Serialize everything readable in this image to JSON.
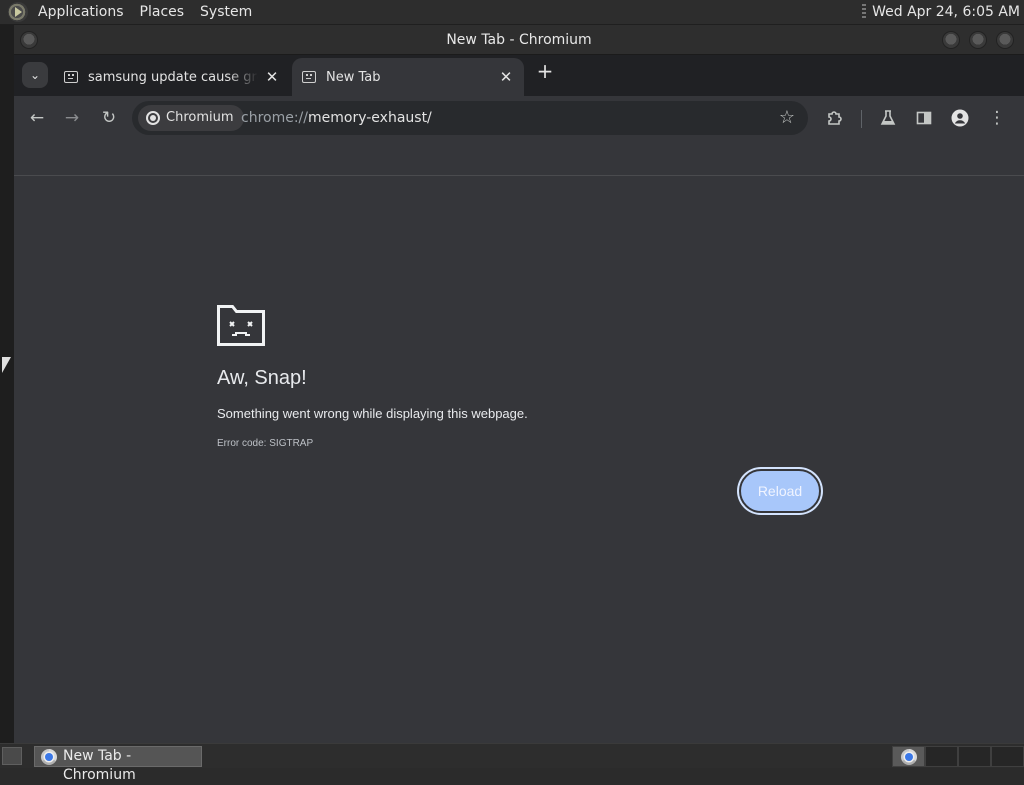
{
  "top_panel": {
    "menus": [
      "Applications",
      "Places",
      "System"
    ],
    "clock": "Wed Apr 24,  6:05 AM"
  },
  "window": {
    "title": "New Tab - Chromium"
  },
  "tabs": [
    {
      "label": "samsung update cause green",
      "active": false,
      "icon": "sad-tab-icon"
    },
    {
      "label": "New Tab",
      "active": true,
      "icon": "sad-tab-icon"
    }
  ],
  "omnibox": {
    "site_chip": "Chromium",
    "url_scheme": "chrome://",
    "url_host": "memory-exhaust/"
  },
  "crash_page": {
    "title": "Aw, Snap!",
    "message": "Something went wrong while displaying this webpage.",
    "error_code": "Error code: SIGTRAP",
    "reload_label": "Reload"
  },
  "taskbar": {
    "task_label": "New Tab - Chromium"
  },
  "colors": {
    "page_bg": "#35363a",
    "accent": "#a8c7fa"
  }
}
